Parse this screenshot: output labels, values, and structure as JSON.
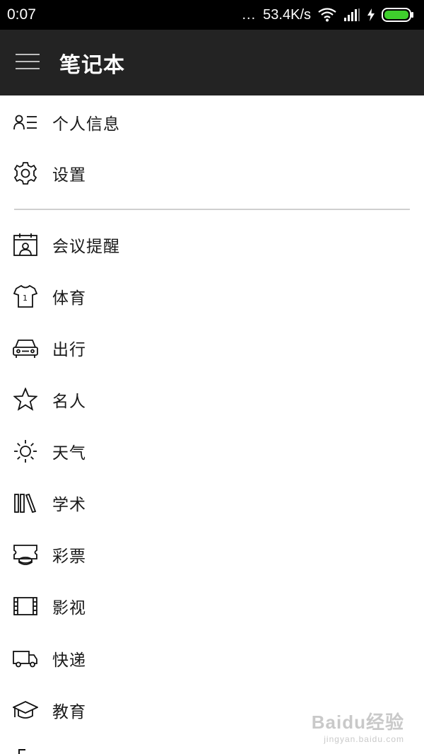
{
  "status_bar": {
    "time": "0:07",
    "more_indicator": "...",
    "network_speed": "53.4K/s",
    "icons": [
      "wifi-icon",
      "signal-icon",
      "charging-icon",
      "battery-icon"
    ]
  },
  "app_bar": {
    "title": "笔记本",
    "menu_icon": "hamburger-menu-icon",
    "background": "#232323"
  },
  "drawer": {
    "top_items": [
      {
        "label": "个人信息",
        "icon": "profile-list-icon"
      },
      {
        "label": "设置",
        "icon": "gear-icon"
      }
    ],
    "category_items": [
      {
        "label": "会议提醒",
        "icon": "meeting-calendar-icon"
      },
      {
        "label": "体育",
        "icon": "jersey-icon"
      },
      {
        "label": "出行",
        "icon": "car-icon"
      },
      {
        "label": "名人",
        "icon": "star-icon"
      },
      {
        "label": "天气",
        "icon": "sun-icon"
      },
      {
        "label": "学术",
        "icon": "books-icon"
      },
      {
        "label": "彩票",
        "icon": "ticket-icon"
      },
      {
        "label": "影视",
        "icon": "film-icon"
      },
      {
        "label": "快递",
        "icon": "truck-icon"
      },
      {
        "label": "教育",
        "icon": "graduation-cap-icon"
      }
    ]
  },
  "watermark": {
    "main": "Baidu经验",
    "sub": "jingyan.baidu.com"
  }
}
